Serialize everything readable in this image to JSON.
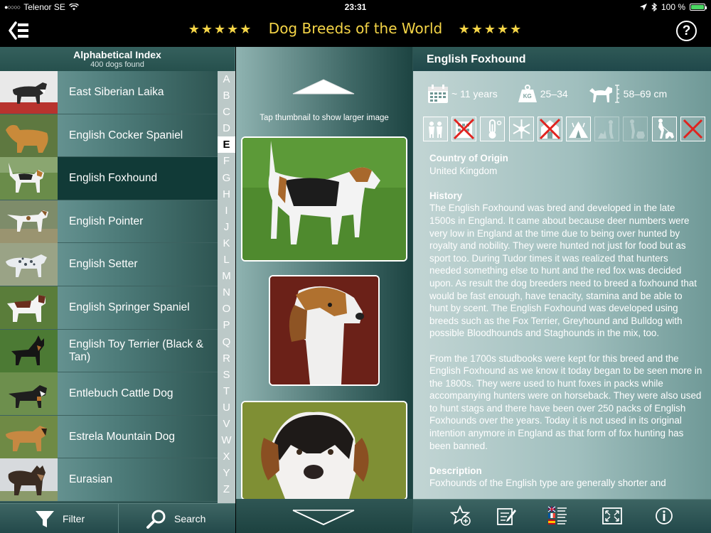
{
  "status": {
    "carrier": "Telenor SE",
    "time": "23:31",
    "battery": "100 %"
  },
  "header": {
    "title": "Dog Breeds of the World",
    "stars": "★★★★★",
    "help": "?"
  },
  "index_panel": {
    "title": "Alphabetical Index",
    "subtitle": "400 dogs found",
    "items": [
      {
        "label": "East Siberian Laika"
      },
      {
        "label": "English Cocker Spaniel"
      },
      {
        "label": "English Foxhound",
        "selected": true
      },
      {
        "label": "English Pointer"
      },
      {
        "label": "English Setter"
      },
      {
        "label": "English Springer Spaniel"
      },
      {
        "label": "English Toy Terrier (Black & Tan)"
      },
      {
        "label": "Entlebuch Cattle Dog"
      },
      {
        "label": "Estrela Mountain Dog"
      },
      {
        "label": "Eurasian"
      }
    ],
    "letters": [
      "A",
      "B",
      "C",
      "D",
      "E",
      "F",
      "G",
      "H",
      "I",
      "J",
      "K",
      "L",
      "M",
      "N",
      "O",
      "P",
      "Q",
      "R",
      "S",
      "T",
      "U",
      "V",
      "W",
      "X",
      "Y",
      "Z"
    ],
    "current_letter": "E"
  },
  "toolbar_left": {
    "filter": "Filter",
    "search": "Search"
  },
  "gallery": {
    "hint": "Tap thumbnail to show larger image"
  },
  "detail": {
    "breed": "English Foxhound",
    "lifespan": "~ 11 years",
    "weight": "25–34",
    "weight_unit": "KG",
    "height": "58–69 cm",
    "origin_heading": "Country of Origin",
    "origin": "United Kingdom",
    "history_heading": "History",
    "history_p1": "The English Foxhound was bred and developed in the late 1500s in England. It came about because deer numbers were very low in England at the time due to being over hunted by royalty and nobility. They were hunted not just for food but as sport too. During Tudor times it was realized that hunters needed something else to hunt and the red fox was decided upon. As result the dog breeders need to breed a foxhound that would be fast enough, have tenacity, stamina and be able to hunt by scent. The English Foxhound was developed using breeds such as the Fox Terrier, Greyhound and Bulldog with possible Bloodhounds and Staghounds in the mix, too.",
    "history_p2": "From the 1700s studbooks were kept for this breed and the English Foxhound as we know it today began to be seen more in the 1800s. They were used to hunt foxes in packs while accompanying hunters were on horseback. They were also used to hunt stags and there have been over 250 packs of English Foxhounds over the years. Today it is not used in its original intention anymore in England as that form of fox hunting has been banned.",
    "description_heading": "Description",
    "description_p1": "Foxhounds of the English type are generally shorter and"
  }
}
